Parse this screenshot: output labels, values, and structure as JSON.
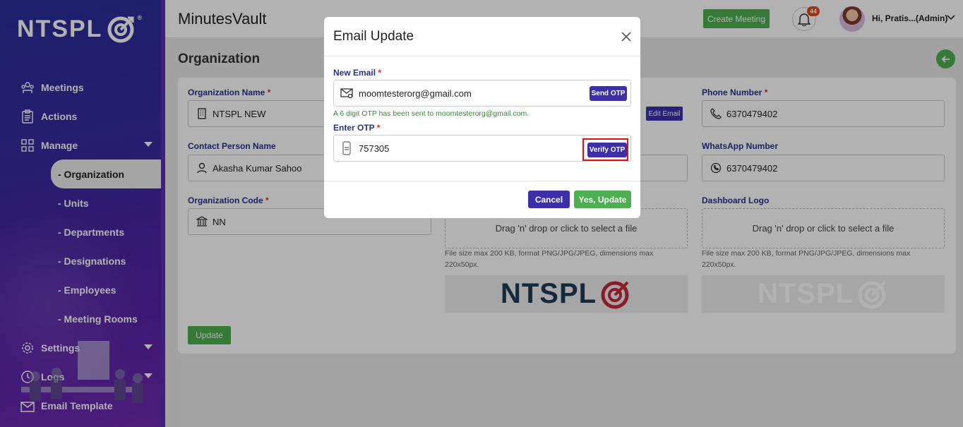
{
  "app": {
    "brand": "NTSPL",
    "title": "MinutesVault"
  },
  "header": {
    "create_meeting": "Create Meeting",
    "notification_count": "44",
    "user_greeting": "Hi, Pratis...(Admin)"
  },
  "sidebar": {
    "items": [
      {
        "label": "Meetings",
        "icon": "meetings-icon"
      },
      {
        "label": "Actions",
        "icon": "actions-icon"
      },
      {
        "label": "Manage",
        "icon": "manage-icon"
      }
    ],
    "manage_sub": [
      {
        "label": "- Organization",
        "active": true
      },
      {
        "label": "- Units"
      },
      {
        "label": "- Departments"
      },
      {
        "label": "- Designations"
      },
      {
        "label": "- Employees"
      },
      {
        "label": "- Meeting Rooms"
      }
    ],
    "bottom_items": [
      {
        "label": "Settings"
      },
      {
        "label": "Logs"
      },
      {
        "label": "Email Template"
      }
    ]
  },
  "page": {
    "title": "Organization",
    "fields": {
      "org_name": {
        "label": "Organization Name",
        "value": "NTSPL NEW"
      },
      "contact_person": {
        "label": "Contact Person Name",
        "value": "Akasha Kumar Sahoo"
      },
      "org_code": {
        "label": "Organization Code",
        "value": "NN"
      },
      "phone": {
        "label": "Phone Number",
        "value": "6370479402"
      },
      "whatsapp": {
        "label": "WhatsApp Number",
        "value": "6370479402"
      },
      "edit_email": "Edit Email"
    },
    "uploads": {
      "drop_text": "Drag 'n' drop or click to select a file",
      "hint": "File size max 200 KB, format PNG/JPG/JPEG, dimensions max 220x50px.",
      "dashboard_logo_label": "Dashboard Logo"
    },
    "update_button": "Update"
  },
  "modal": {
    "title": "Email Update",
    "new_email_label": "New Email",
    "new_email_value": "moomtesterorg@gmail.com",
    "send_otp": "Send OTP",
    "otp_note": "A 6 digit OTP has been sent to moomtesterorg@gmail.com.",
    "otp_label": "Enter OTP",
    "otp_value": "757305",
    "verify_otp": "Verify OTP",
    "cancel": "Cancel",
    "confirm": "Yes, Update"
  },
  "colors": {
    "primary": "#3d2fa8",
    "success": "#4caf50",
    "label": "#2b2f8f",
    "required": "#d32f2f",
    "highlight": "#e01010",
    "brand_red": "#c8283c",
    "brand_dark": "#1f3b57"
  }
}
